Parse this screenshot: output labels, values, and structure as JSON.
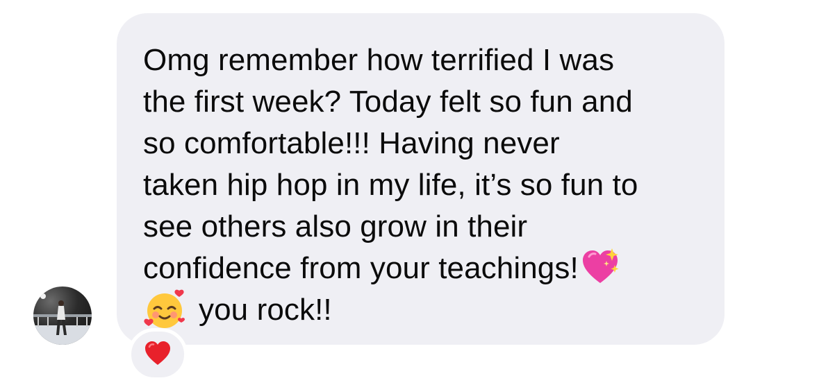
{
  "message": {
    "lines": [
      "Omg remember how terrified I was",
      "the first week? Today felt so fun and",
      "so comfortable!!! Having never",
      "taken hip hop in my life, it’s so fun to",
      "see others also grow in their",
      "confidence from your teachings!"
    ],
    "last_line": "you rock!!",
    "emojis": [
      "sparkling-heart-icon",
      "smiling-face-with-hearts-icon"
    ]
  },
  "reaction": {
    "icon": "red-heart-icon",
    "color": "#e8212b"
  },
  "colors": {
    "bubble": "#efeff4",
    "text": "#0b0b0b"
  }
}
